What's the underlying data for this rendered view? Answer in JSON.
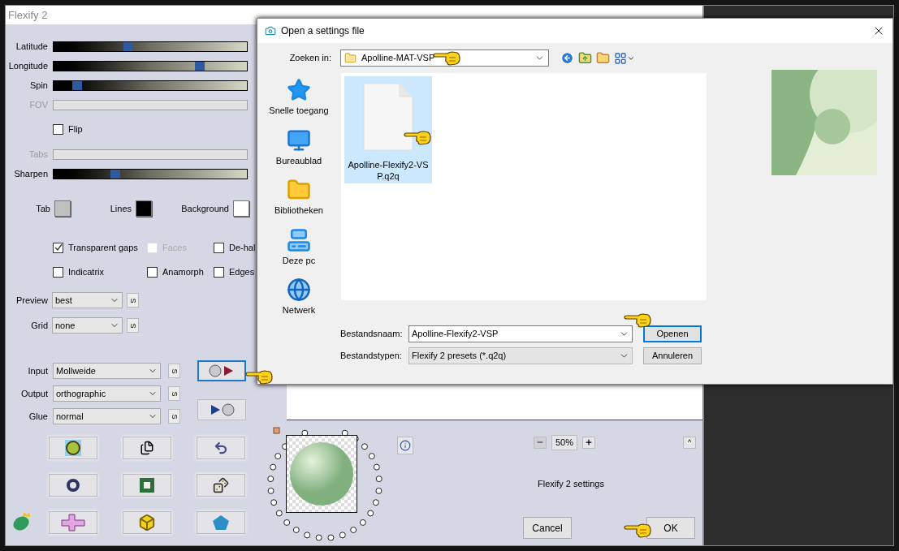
{
  "flexify": {
    "title": "Flexify 2",
    "controls": [
      {
        "kind": "slider",
        "label": "Latitude",
        "level": 0.38,
        "disabled": false
      },
      {
        "kind": "slider",
        "label": "Longitude",
        "level": 0.77,
        "disabled": false
      },
      {
        "kind": "slider",
        "label": "Spin",
        "level": 0.1,
        "disabled": false
      },
      {
        "kind": "slider",
        "label": "FOV",
        "disabled": true
      },
      {
        "kind": "checkbox",
        "label": "Flip",
        "checked": false,
        "disabled": false
      },
      {
        "kind": "slider",
        "label": "Tabs",
        "disabled": true
      },
      {
        "kind": "slider",
        "label": "Sharpen",
        "level": 0.31,
        "disabled": false
      }
    ],
    "colors": [
      {
        "label": "Tab",
        "color": "#c0c0c0"
      },
      {
        "label": "Lines",
        "color": "#000000"
      },
      {
        "label": "Background",
        "color": "#ffffff"
      }
    ],
    "options": [
      {
        "label": "Transparent gaps",
        "checked": true,
        "disabled": false
      },
      {
        "label": "Faces",
        "checked": false,
        "disabled": true
      },
      {
        "label": "De-hal",
        "checked": false,
        "disabled": false
      },
      {
        "label": "Indicatrix",
        "checked": false,
        "disabled": false
      },
      {
        "label": "Anamorph",
        "checked": false,
        "disabled": false
      },
      {
        "label": "Edges",
        "checked": false,
        "disabled": false
      }
    ],
    "view_selects": [
      {
        "label": "Preview",
        "value": "best",
        "button": "S"
      },
      {
        "label": "Grid",
        "value": "none",
        "button": "S"
      }
    ],
    "mapping_selects": [
      {
        "label": "Input",
        "value": "Mollweide",
        "button": "S"
      },
      {
        "label": "Output",
        "value": "orthographic",
        "button": "S"
      },
      {
        "label": "Glue",
        "value": "normal",
        "button": "S"
      }
    ],
    "zoom": "50%",
    "collapse": "^",
    "status": "Flexify 2 settings",
    "buttons": [
      "Cancel",
      "OK"
    ]
  },
  "dialog": {
    "title": "Open a settings file",
    "look_in_label": "Zoeken in:",
    "look_in_value": "Apolline-MAT-VSP",
    "places": [
      {
        "kind": "star",
        "label": "Snelle toegang",
        "selected": false
      },
      {
        "kind": "desktop",
        "label": "Bureaublad",
        "selected": false
      },
      {
        "kind": "libraries",
        "label": "Bibliotheken",
        "selected": false
      },
      {
        "kind": "pc",
        "label": "Deze pc",
        "selected": false
      },
      {
        "kind": "network",
        "label": "Netwerk",
        "selected": false
      }
    ],
    "files": [
      {
        "name": "Apolline-Flexify2-VSP.q2q",
        "selected": true
      }
    ],
    "filename_label": "Bestandsnaam:",
    "filename_value": "Apolline-Flexify2-VSP",
    "filetype_label": "Bestandstypen:",
    "filetype_value": "Flexify 2 presets (*.q2q)",
    "buttons": [
      "Openen",
      "Annuleren"
    ]
  }
}
